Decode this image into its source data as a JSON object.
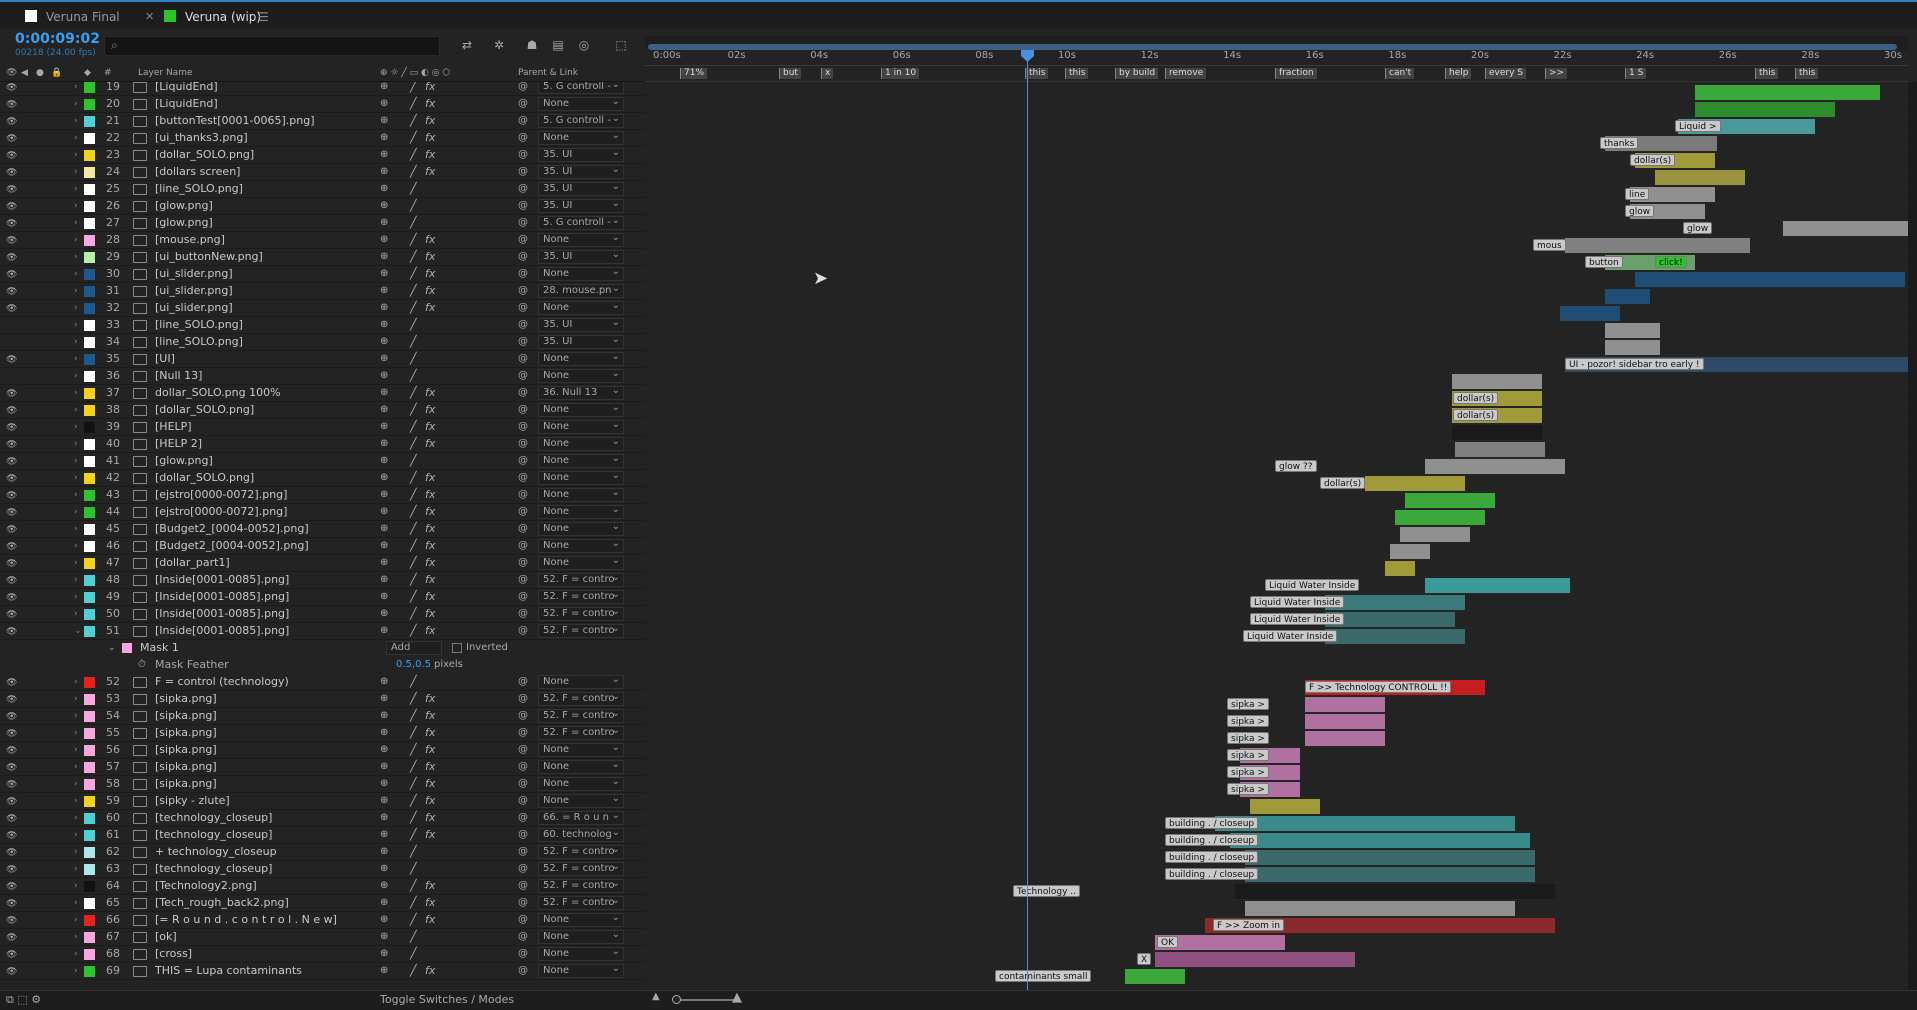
{
  "tabs": [
    {
      "label": "Veruna Final",
      "color": "#ffffff"
    },
    {
      "label": "Veruna (wip)",
      "color": "#2dc32d"
    }
  ],
  "timecode": "0:00:09:02",
  "fps": "00218 (24.00 fps)",
  "columns": {
    "num": "#",
    "layer_name": "Layer Name",
    "parent": "Parent & Link"
  },
  "ruler": [
    "0:00s",
    "02s",
    "04s",
    "06s",
    "08s",
    "10s",
    "12s",
    "14s",
    "16s",
    "18s",
    "20s",
    "22s",
    "24s",
    "26s",
    "28s",
    "30s"
  ],
  "markers": [
    "71%",
    "but",
    "x",
    "1 in 10",
    "this",
    "this",
    "by build",
    "remove",
    "fraction",
    "can't",
    "help",
    "every S",
    ">>",
    "1 S",
    "this",
    "this"
  ],
  "layers": [
    {
      "num": "19",
      "color": "#2dc32d",
      "name": "[LiquidEnd]",
      "parent": "5. G controll -",
      "eye": true,
      "fx": true
    },
    {
      "num": "20",
      "color": "#2dc32d",
      "name": "[LiquidEnd]",
      "parent": "None",
      "eye": true,
      "fx": true
    },
    {
      "num": "21",
      "color": "#4fd1d1",
      "name": "[buttonTest[0001-0065].png]",
      "parent": "5. G controll -",
      "eye": true,
      "fx": true
    },
    {
      "num": "22",
      "color": "#ffffff",
      "name": "[ui_thanks3.png]",
      "parent": "None",
      "eye": true,
      "fx": true
    },
    {
      "num": "23",
      "color": "#f2d21b",
      "name": "[dollar_SOLO.png]",
      "parent": "35. UI",
      "eye": true,
      "fx": true
    },
    {
      "num": "24",
      "color": "#f3e9a0",
      "name": "[dollars screen]",
      "parent": "35. UI",
      "eye": true,
      "fx": true
    },
    {
      "num": "25",
      "color": "#ffffff",
      "name": "[line_SOLO.png]",
      "parent": "35. UI",
      "eye": true,
      "fx": false
    },
    {
      "num": "26",
      "color": "#ffffff",
      "name": "[glow.png]",
      "parent": "35. UI",
      "eye": true,
      "fx": false
    },
    {
      "num": "27",
      "color": "#ffffff",
      "name": "[glow.png]",
      "parent": "5. G controll -",
      "eye": true,
      "fx": false
    },
    {
      "num": "28",
      "color": "#f8a6e0",
      "name": "[mouse.png]",
      "parent": "None",
      "eye": true,
      "fx": true
    },
    {
      "num": "29",
      "color": "#b5f0a9",
      "name": "[ui_buttonNew.png]",
      "parent": "35. UI",
      "eye": true,
      "fx": true
    },
    {
      "num": "30",
      "color": "#1b5a8f",
      "name": "[ui_slider.png]",
      "parent": "None",
      "eye": true,
      "fx": true
    },
    {
      "num": "31",
      "color": "#1b5a8f",
      "name": "[ui_slider.png]",
      "parent": "28. mouse.pn",
      "eye": true,
      "fx": true
    },
    {
      "num": "32",
      "color": "#1b5a8f",
      "name": "[ui_slider.png]",
      "parent": "None",
      "eye": true,
      "fx": true
    },
    {
      "num": "33",
      "color": "#ffffff",
      "name": "[line_SOLO.png]",
      "parent": "35. UI",
      "eye": false,
      "fx": false
    },
    {
      "num": "34",
      "color": "#ffffff",
      "name": "[line_SOLO.png]",
      "parent": "35. UI",
      "eye": false,
      "fx": false
    },
    {
      "num": "35",
      "color": "#1b5a8f",
      "name": "[UI]",
      "parent": "None",
      "eye": true,
      "fx": false
    },
    {
      "num": "36",
      "color": "#ffffff",
      "name": "[Null 13]",
      "parent": "None",
      "eye": false,
      "fx": false
    },
    {
      "num": "37",
      "color": "#f2d21b",
      "name": "dollar_SOLO.png 100%",
      "parent": "36. Null 13",
      "eye": true,
      "fx": true
    },
    {
      "num": "38",
      "color": "#f2d21b",
      "name": "[dollar_SOLO.png]",
      "parent": "None",
      "eye": true,
      "fx": true
    },
    {
      "num": "39",
      "color": "#111111",
      "name": "[HELP]",
      "parent": "None",
      "eye": true,
      "fx": true
    },
    {
      "num": "40",
      "color": "#ffffff",
      "name": "[HELP 2]",
      "parent": "None",
      "eye": true,
      "fx": true
    },
    {
      "num": "41",
      "color": "#ffffff",
      "name": "[glow.png]",
      "parent": "None",
      "eye": true,
      "fx": false
    },
    {
      "num": "42",
      "color": "#f2d21b",
      "name": "[dollar_SOLO.png]",
      "parent": "None",
      "eye": true,
      "fx": true
    },
    {
      "num": "43",
      "color": "#2dc32d",
      "name": "[ejstro[0000-0072].png]",
      "parent": "None",
      "eye": true,
      "fx": true
    },
    {
      "num": "44",
      "color": "#2dc32d",
      "name": "[ejstro[0000-0072].png]",
      "parent": "None",
      "eye": true,
      "fx": true
    },
    {
      "num": "45",
      "color": "#ffffff",
      "name": "[Budget2_[0004-0052].png]",
      "parent": "None",
      "eye": true,
      "fx": true
    },
    {
      "num": "46",
      "color": "#ffffff",
      "name": "[Budget2_[0004-0052].png]",
      "parent": "None",
      "eye": true,
      "fx": true
    },
    {
      "num": "47",
      "color": "#f2d21b",
      "name": "[dollar_part1]",
      "parent": "None",
      "eye": true,
      "fx": true
    },
    {
      "num": "48",
      "color": "#4fd1d1",
      "name": "[Inside[0001-0085].png]",
      "parent": "52. F = contro",
      "eye": true,
      "fx": true
    },
    {
      "num": "49",
      "color": "#4fd1d1",
      "name": "[Inside[0001-0085].png]",
      "parent": "52. F = contro",
      "eye": true,
      "fx": true
    },
    {
      "num": "50",
      "color": "#4fd1d1",
      "name": "[Inside[0001-0085].png]",
      "parent": "52. F = contro",
      "eye": true,
      "fx": true
    },
    {
      "num": "51",
      "color": "#4fd1d1",
      "name": "[Inside[0001-0085].png]",
      "parent": "52. F = contro",
      "eye": true,
      "fx": true
    }
  ],
  "mask": {
    "name": "Mask 1",
    "mode": "Add",
    "inverted": "Inverted",
    "feather_label": "Mask Feather",
    "feather_value": "0.5,0.5",
    "feather_unit": "pixels"
  },
  "layers2": [
    {
      "num": "52",
      "color": "#e8221b",
      "name": "F = control (technology)",
      "parent": "None",
      "eye": true,
      "fx": false
    },
    {
      "num": "53",
      "color": "#f8a6e0",
      "name": "[sipka.png]",
      "parent": "52. F = contro",
      "eye": true,
      "fx": true
    },
    {
      "num": "54",
      "color": "#f8a6e0",
      "name": "[sipka.png]",
      "parent": "52. F = contro",
      "eye": true,
      "fx": true
    },
    {
      "num": "55",
      "color": "#f8a6e0",
      "name": "[sipka.png]",
      "parent": "52. F = contro",
      "eye": true,
      "fx": true
    },
    {
      "num": "56",
      "color": "#f8a6e0",
      "name": "[sipka.png]",
      "parent": "None",
      "eye": true,
      "fx": true
    },
    {
      "num": "57",
      "color": "#f8a6e0",
      "name": "[sipka.png]",
      "parent": "None",
      "eye": true,
      "fx": true
    },
    {
      "num": "58",
      "color": "#f8a6e0",
      "name": "[sipka.png]",
      "parent": "None",
      "eye": true,
      "fx": true
    },
    {
      "num": "59",
      "color": "#f2d21b",
      "name": "[sipky - zlute]",
      "parent": "None",
      "eye": true,
      "fx": true
    },
    {
      "num": "60",
      "color": "#4fd1d1",
      "name": "[technology_closeup]",
      "parent": "66. = R o u n",
      "eye": true,
      "fx": true
    },
    {
      "num": "61",
      "color": "#4fd1d1",
      "name": "[technology_closeup]",
      "parent": "60. technolog",
      "eye": true,
      "fx": true
    },
    {
      "num": "62",
      "color": "#a8e8e8",
      "name": "+ technology_closeup",
      "parent": "52. F = contro",
      "eye": true,
      "fx": false
    },
    {
      "num": "63",
      "color": "#a8e8e8",
      "name": "[technology_closeup]",
      "parent": "52. F = contro",
      "eye": true,
      "fx": false
    },
    {
      "num": "64",
      "color": "#111111",
      "name": "[Technology2.png]",
      "parent": "52. F = contro",
      "eye": true,
      "fx": true
    },
    {
      "num": "65",
      "color": "#ffffff",
      "name": "[Tech_rough_back2.png]",
      "parent": "52. F = contro",
      "eye": true,
      "fx": true
    },
    {
      "num": "66",
      "color": "#e8221b",
      "name": "[= R o u n d . c o n t r o l . N e w]",
      "parent": "None",
      "eye": true,
      "fx": true
    },
    {
      "num": "67",
      "color": "#f8a6e0",
      "name": "[ok]",
      "parent": "None",
      "eye": true,
      "fx": false
    },
    {
      "num": "68",
      "color": "#f8a6e0",
      "name": "[cross]",
      "parent": "None",
      "eye": true,
      "fx": false
    },
    {
      "num": "69",
      "color": "#2dc32d",
      "name": "THIS = Lupa contaminants",
      "parent": "None",
      "eye": true,
      "fx": true
    }
  ],
  "bar_labels": {
    "21": "Liquid >",
    "22": "thanks",
    "23": "dollar(s)",
    "25": "line",
    "26": "glow",
    "27": "glow",
    "28": "mous",
    "29": "button",
    "29b": "click!",
    "35": "UI - pozor! sidebar tro early !",
    "37": "dollar(s)",
    "38": "dollar(s)",
    "41": "glow ??",
    "42": "dollar(s)",
    "48": "Liquid Water Inside",
    "49": "Liquid Water Inside",
    "50": "Liquid Water Inside",
    "51": "Liquid Water Inside",
    "52": "F >> Technology CONTROLL !!",
    "53": "sipka >",
    "54": "sipka >",
    "55": "sipka >",
    "56": "sipka >",
    "57": "sipka >",
    "58": "sipka >",
    "60": "building . / closeup",
    "61": "building . / closeup",
    "62": "building . / closeup",
    "63": "building . / closeup",
    "64": "Technology ..",
    "66": "F >> Zoom in",
    "67": "OK",
    "68": "X",
    "69": "contaminants small"
  },
  "toggle_label": "Toggle Switches / Modes",
  "icons": [
    "search-icon",
    "eye-icon",
    "solo-icon",
    "lock-icon",
    "graph-editor-icon",
    "motion-blur-icon"
  ]
}
